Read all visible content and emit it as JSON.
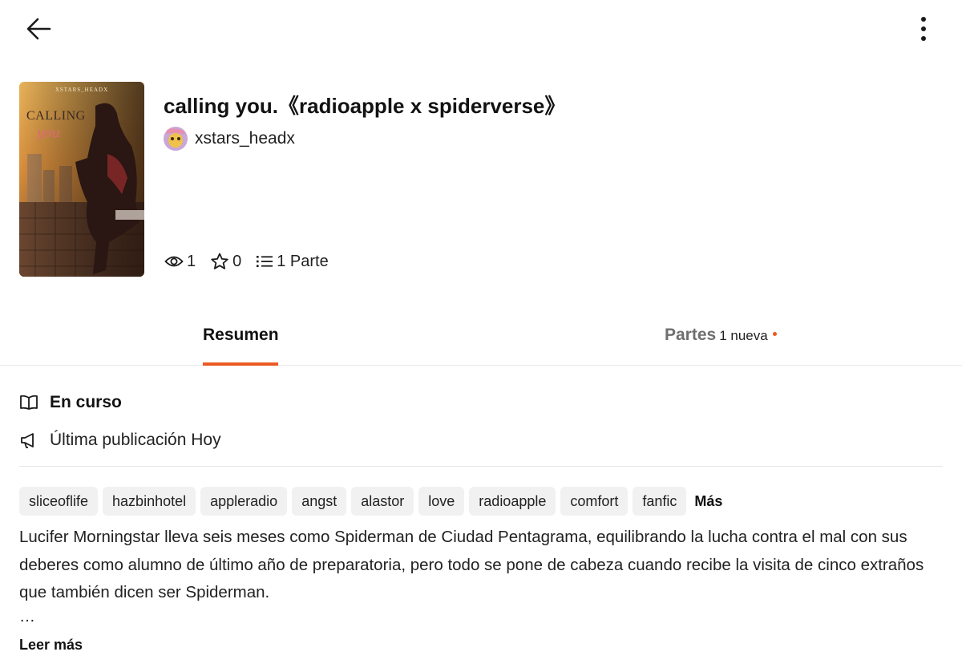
{
  "header": {
    "back_icon": "arrow-left-icon",
    "more_icon": "more-vertical-icon"
  },
  "story": {
    "cover": {
      "top_text": "XSTARS_HEADX",
      "title_text": "CALLING",
      "subtitle_text": "you"
    },
    "title": "calling you.《radioapple x spiderverse》",
    "author": "xstars_headx",
    "stats": {
      "reads": "1",
      "votes": "0",
      "parts": "1 Parte"
    }
  },
  "tabs": {
    "summary": "Resumen",
    "parts": "Partes",
    "parts_badge": "1 nueva"
  },
  "details": {
    "status": "En curso",
    "last_published": "Última publicación Hoy"
  },
  "tags": [
    "sliceoflife",
    "hazbinhotel",
    "appleradio",
    "angst",
    "alastor",
    "love",
    "radioapple",
    "comfort",
    "fanfic"
  ],
  "tags_more": "Más",
  "description": "Lucifer Morningstar lleva seis meses como Spiderman de Ciudad Pentagrama, equilibrando la lucha contra el mal con sus deberes como alumno de último año de preparatoria, pero todo se pone de cabeza cuando recibe la visita de cinco extraños que también dicen ser Spiderman.",
  "ellipsis": "…",
  "read_more": "Leer más",
  "colors": {
    "accent": "#ec5a24",
    "tag_bg": "#f1f1f1",
    "text": "#222222"
  }
}
